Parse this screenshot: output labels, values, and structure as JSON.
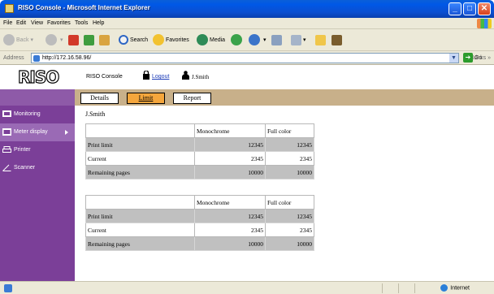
{
  "window": {
    "title": "RISO Console - Microsoft Internet Explorer"
  },
  "menubar": {
    "items": [
      "File",
      "Edit",
      "View",
      "Favorites",
      "Tools",
      "Help"
    ]
  },
  "toolbar": {
    "back": "Back",
    "search": "Search",
    "favorites": "Favorites",
    "media": "Media"
  },
  "address": {
    "label": "Address",
    "url": "http://172.16.58.96/",
    "go": "Go",
    "links": "Links"
  },
  "header": {
    "logo": "RISO",
    "console": "RISO Console",
    "logout": "Logout",
    "user": "J.Smith"
  },
  "sidebar": {
    "items": [
      {
        "label": "Monitoring",
        "icon": "monitoring-icon"
      },
      {
        "label": "Meter display",
        "icon": "meter-icon"
      },
      {
        "label": "Printer",
        "icon": "printer-icon"
      },
      {
        "label": "Scanner",
        "icon": "scanner-icon"
      }
    ]
  },
  "tabs": [
    {
      "label": "Details"
    },
    {
      "label": "Limit"
    },
    {
      "label": "Report"
    }
  ],
  "content": {
    "user": "J.Smith",
    "tables": [
      {
        "headers": [
          "",
          "Monochrome",
          "Full color"
        ],
        "rows": [
          [
            "Print limit",
            "12345",
            "12345"
          ],
          [
            "Current",
            "2345",
            "2345"
          ],
          [
            "Remaining pages",
            "10000",
            "10000"
          ]
        ]
      },
      {
        "headers": [
          "",
          "Monochrome",
          "Full color"
        ],
        "rows": [
          [
            "Print limit",
            "12345",
            "12345"
          ],
          [
            "Current",
            "2345",
            "2345"
          ],
          [
            "Remaining pages",
            "10000",
            "10000"
          ]
        ]
      }
    ]
  },
  "statusbar": {
    "zone": "Internet"
  },
  "colors": {
    "sidebar": "#7b3f98",
    "tabstrip": "#c8b08a",
    "active_tab": "#f5a63c",
    "shaded_row": "#c0c0c0"
  }
}
